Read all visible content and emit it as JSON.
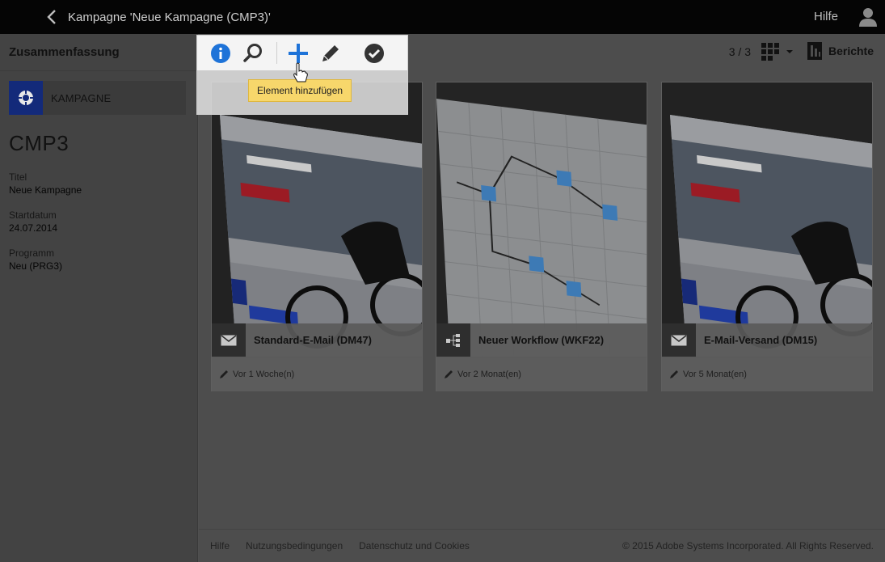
{
  "header": {
    "title": "Kampagne 'Neue Kampagne (CMP3)'",
    "help": "Hilfe"
  },
  "sidebar": {
    "heading": "Zusammenfassung",
    "tile_label": "KAMPAGNE",
    "campaign_code": "CMP3",
    "fields": [
      {
        "label": "Titel",
        "value": "Neue Kampagne"
      },
      {
        "label": "Startdatum",
        "value": "24.07.2014"
      },
      {
        "label": "Programm",
        "value": "Neu (PRG3)"
      }
    ]
  },
  "toolbar": {
    "counter": "3 / 3",
    "reports_label": "Berichte",
    "actions": [
      "info-icon",
      "search-icon",
      "add-icon",
      "edit-icon",
      "approve-icon"
    ],
    "tooltip": "Element hinzufügen"
  },
  "cards": [
    {
      "title": "Standard-E-Mail (DM47)",
      "date": "Vor 1 Woche(n)",
      "type_icon": "email-icon",
      "thumbnail": "email-template"
    },
    {
      "title": "Neuer Workflow (WKF22)",
      "date": "Vor 2 Monat(en)",
      "type_icon": "workflow-icon",
      "thumbnail": "workflow-diagram"
    },
    {
      "title": "E-Mail-Versand (DM15)",
      "date": "Vor 5 Monat(en)",
      "type_icon": "email-icon",
      "thumbnail": "email-template"
    }
  ],
  "footer": {
    "links": [
      "Hilfe",
      "Nutzungsbedingungen",
      "Datenschutz und Cookies"
    ],
    "copyright": "© 2015 Adobe Systems Incorporated. All Rights Reserved."
  },
  "colors": {
    "accent": "#1e73d8",
    "tooltip": "#f7d76b",
    "campaign_icon_bg": "#132a7a"
  }
}
